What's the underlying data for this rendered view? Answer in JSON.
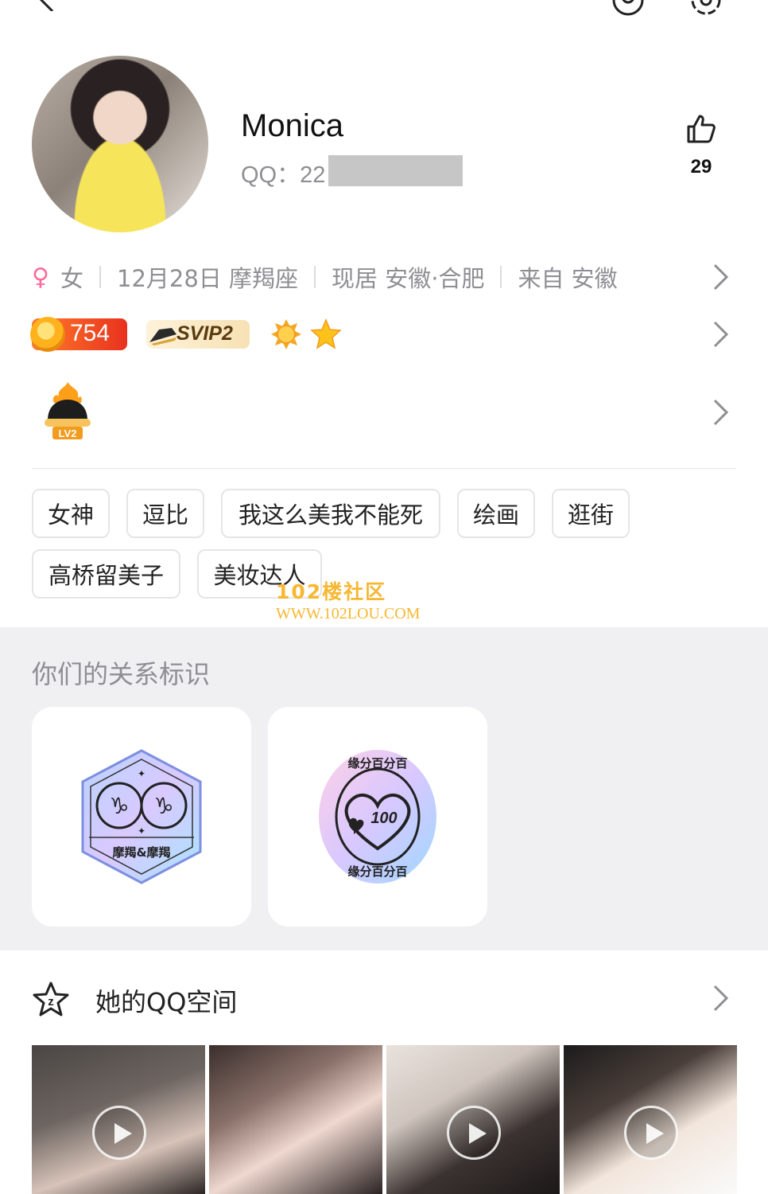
{
  "profile": {
    "name": "Monica",
    "qq_label": "QQ：22",
    "likes": "29"
  },
  "info": {
    "gender": "女",
    "birthday": "12月28日 摩羯座",
    "residence": "现居 安徽·合肥",
    "hometown": "来自 安徽"
  },
  "badges": {
    "coin_value": "754",
    "svip_label": "SVIP2",
    "level_badge_label": "LV2"
  },
  "tags": [
    "女神",
    "逗比",
    "我这么美我不能死",
    "绘画",
    "逛街",
    "高桥留美子",
    "美妆达人"
  ],
  "watermark": {
    "line1": "102楼社区",
    "line2": "WWW.102LOU.COM"
  },
  "relationship": {
    "title": "你们的关系标识",
    "zodiac_badge_label": "摩羯&摩羯",
    "match_badge_top": "缘分百分百",
    "match_badge_bottom": "缘分百分百",
    "match_badge_number": "100"
  },
  "qzone": {
    "title": "她的QQ空间"
  },
  "colors": {
    "female_accent": "#ff6b9a",
    "section_bg": "#f0f0f2",
    "secondary_text": "#8e8e93"
  },
  "icons": {
    "back": "chevron-left-icon",
    "top_right_1": "user-circle-icon",
    "top_right_2": "gear-icon",
    "like": "thumbs-up-icon",
    "row_arrow": "chevron-right-icon",
    "qzone": "star-icon"
  }
}
